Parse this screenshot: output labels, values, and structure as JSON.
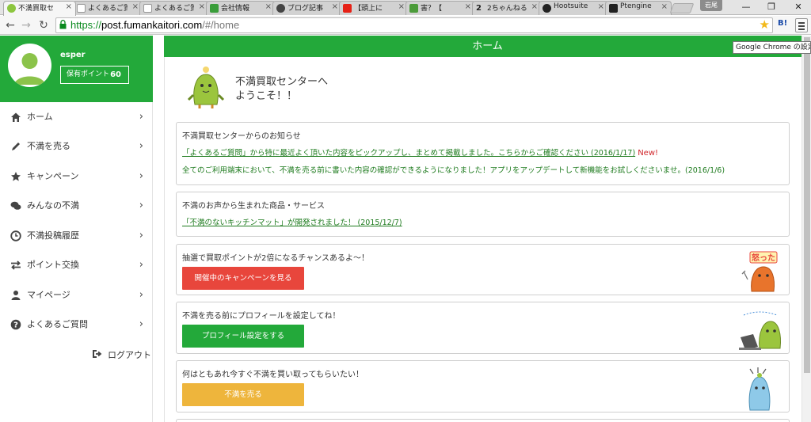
{
  "browser": {
    "tabs": [
      {
        "title": "不満買取セ",
        "active": true,
        "favicon_color": "#8dc63f"
      },
      {
        "title": "よくあるご質",
        "active": false,
        "favicon_color": "#ffffff"
      },
      {
        "title": "よくあるご質",
        "active": false,
        "favicon_color": "#ffffff"
      },
      {
        "title": "会社情報",
        "active": false,
        "favicon_color": "#3a9d3a"
      },
      {
        "title": "ブログ記事",
        "active": false,
        "favicon_color": "#444444"
      },
      {
        "title": "【頭上に",
        "active": false,
        "favicon_color": "#e62117"
      },
      {
        "title": "害？【",
        "active": false,
        "favicon_color": "#4c9b3a"
      },
      {
        "title": "2ちゃんねる",
        "active": false,
        "favicon_color": "#222222"
      },
      {
        "title": "Hootsuite",
        "active": false,
        "favicon_color": "#222222"
      },
      {
        "title": "Ptengine",
        "active": false,
        "favicon_color": "#222222"
      }
    ],
    "profile_label": "岩尾",
    "url_scheme": "https://",
    "url_host": "post.fumankaitori.com",
    "url_path": "/#/home",
    "tooltip": "Google Chrome の設定",
    "ext_label": "B!"
  },
  "sidebar": {
    "username": "esper",
    "points_label": "保有ポイント",
    "points_value": "60",
    "items": [
      {
        "label": "ホーム",
        "icon": "home-icon"
      },
      {
        "label": "不満を売る",
        "icon": "pencil-icon"
      },
      {
        "label": "キャンペーン",
        "icon": "star-icon"
      },
      {
        "label": "みんなの不満",
        "icon": "comments-icon"
      },
      {
        "label": "不満投稿履歴",
        "icon": "clock-icon"
      },
      {
        "label": "ポイント交換",
        "icon": "exchange-icon"
      },
      {
        "label": "マイページ",
        "icon": "user-icon"
      },
      {
        "label": "よくあるご質問",
        "icon": "question-icon"
      }
    ],
    "logout_label": "ログアウト"
  },
  "header": {
    "title": "ホーム"
  },
  "welcome": {
    "line1": "不満買取センターへ",
    "line2": "ようこそ！！"
  },
  "notice": {
    "title": "不満買取センターからのお知らせ",
    "item1_link": "「よくあるご質問」から特に最近よく頂いた内容をピックアップし、まとめて掲載しました。こちらからご確認ください (2016/1/17)",
    "item1_badge": "New!",
    "item2": "全てのご利用端末において、不満を売る前に書いた内容の確認ができるようになりました！アプリをアップデートして新機能をお試しくださいませ。(2016/1/6)"
  },
  "products": {
    "title": "不満のお声から生まれた商品・サービス",
    "item1_link": "「不満のないキッチンマット」が開発されました！ (2015/12/7)"
  },
  "campaign": {
    "text": "抽選で買取ポイントが2倍になるチャンスあるよ〜！",
    "button": "開催中のキャンペーンを見る",
    "mascot_label": "怒った"
  },
  "profile_card": {
    "text": "不満を売る前にプロフィールを設定してね！",
    "button": "プロフィール設定をする"
  },
  "sell_card": {
    "text": "何はともあれ今すぐ不満を買い取ってもらいたい！",
    "button": "不満を売る"
  },
  "colors": {
    "brand_green": "#23a93a",
    "red_button": "#e8463c",
    "yellow_button": "#eeb53c",
    "link_green": "#1e7b1e",
    "new_red": "#d0262b"
  }
}
